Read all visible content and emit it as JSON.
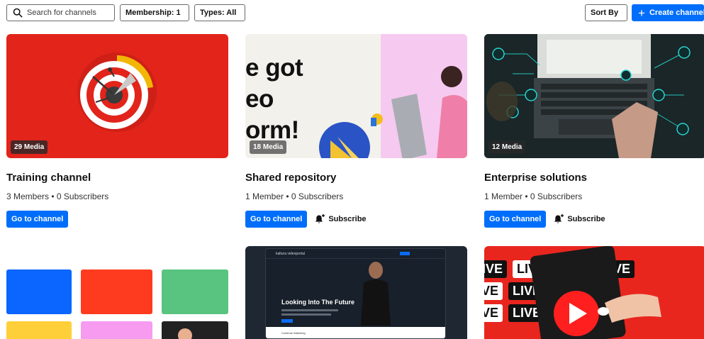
{
  "toolbar": {
    "search_placeholder": "Search for channels",
    "membership_label": "Membership: 1",
    "types_label": "Types: All",
    "sort_label": "Sort By",
    "create_label": "Create channel"
  },
  "colors": {
    "accent": "#006efa",
    "training_bg": "#e2241b",
    "badge_bg": "#282828"
  },
  "channels": [
    {
      "media": "29 Media",
      "title": "Training channel",
      "meta": "3 Members • 0 Subscribers",
      "goto_label": "Go to channel"
    },
    {
      "media": "18 Media",
      "title": "Shared repository",
      "meta": "1 Member • 0 Subscribers",
      "goto_label": "Go to channel",
      "subscribe_label": "Subscribe",
      "thumb_text": [
        "e got",
        "eo",
        "orm!"
      ]
    },
    {
      "media": "12 Media",
      "title": "Enterprise solutions",
      "meta": "1 Member • 0 Subscribers",
      "goto_label": "Go to channel",
      "subscribe_label": "Subscribe"
    }
  ],
  "row2": {
    "video_thumb": {
      "brand": "kaltura videoportal",
      "headline": "Looking Into The Future",
      "section": "Continue Watching"
    },
    "live_thumb": {
      "live_text": "LIVE"
    }
  }
}
